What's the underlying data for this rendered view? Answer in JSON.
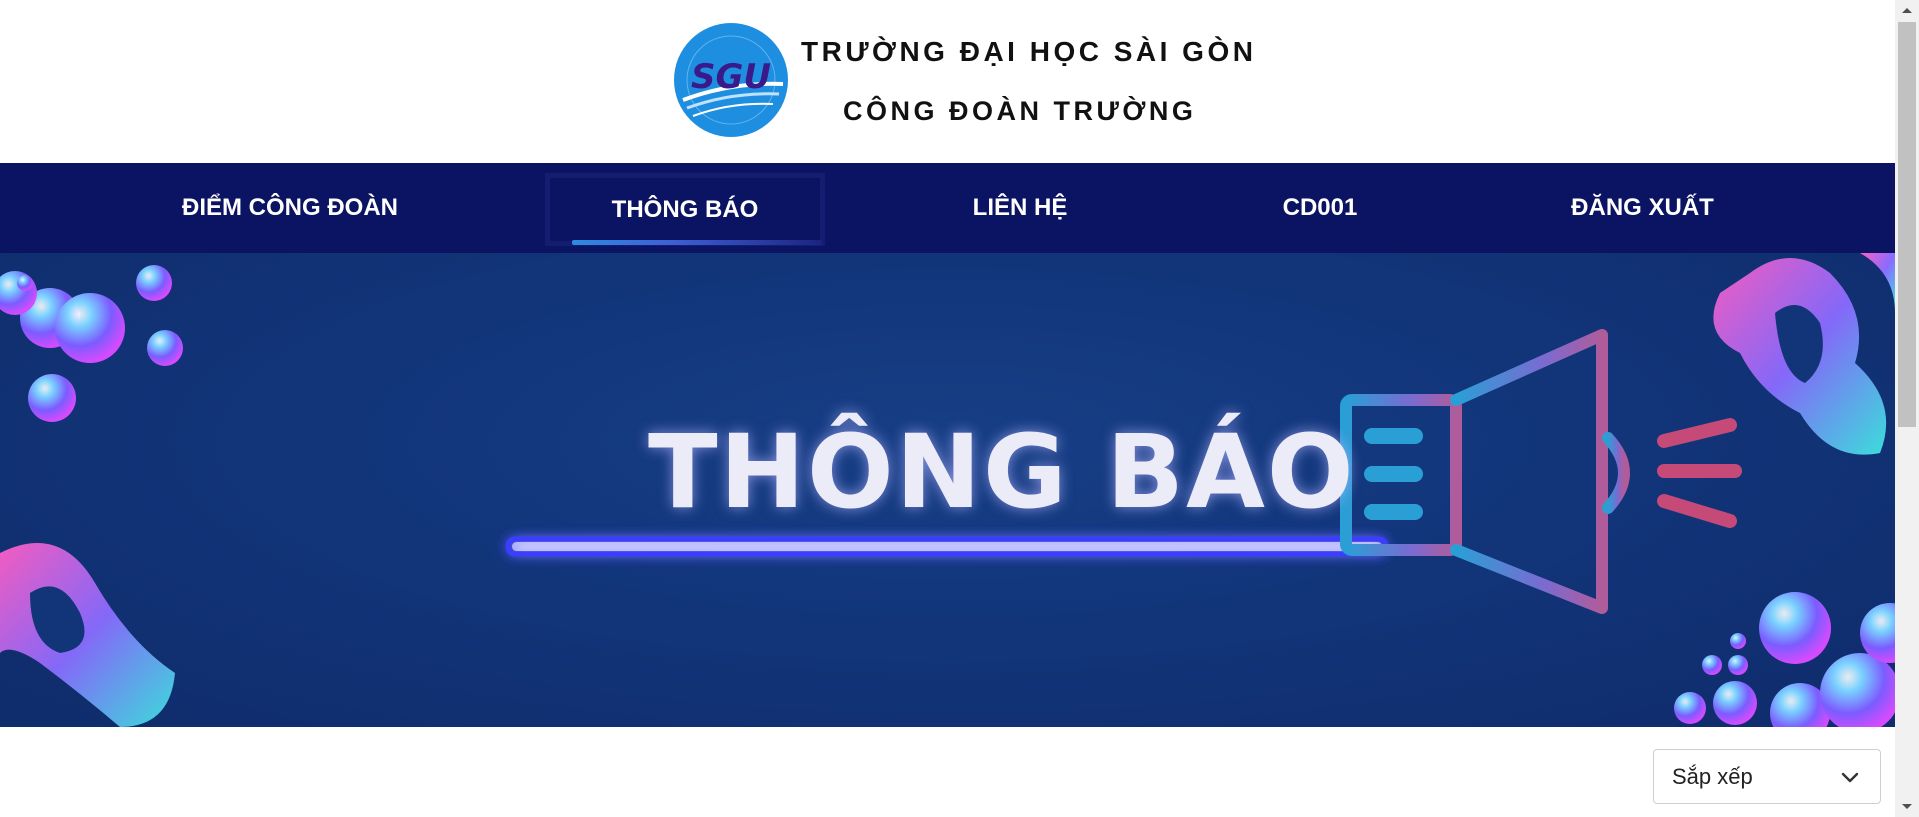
{
  "header": {
    "logo_text": "SGU",
    "title_line1": "TRƯỜNG ĐẠI HỌC SÀI GÒN",
    "title_line2": "CÔNG ĐOÀN TRƯỜNG"
  },
  "nav": {
    "items": [
      {
        "label": "ĐIỂM CÔNG ĐOÀN"
      },
      {
        "label": "THÔNG BÁO",
        "active": true
      },
      {
        "label": "LIÊN HỆ"
      },
      {
        "label": "CD001"
      },
      {
        "label": "ĐĂNG XUẤT"
      }
    ]
  },
  "banner": {
    "title": "THÔNG BÁO",
    "icon": "megaphone-icon"
  },
  "sort": {
    "label": "Sắp xếp",
    "icon": "chevron-down-icon"
  },
  "colors": {
    "nav_bg": "#0b1363",
    "banner_bg": "#12357a",
    "neon_line": "#3a3cff",
    "logo_blue": "#1e88e5",
    "logo_text": "#3a1a8a"
  }
}
